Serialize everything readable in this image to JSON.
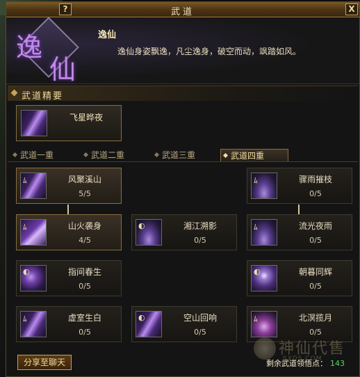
{
  "window": {
    "title": "武道",
    "help_label": "?",
    "close_label": "X"
  },
  "header": {
    "emblem_char1": "逸",
    "emblem_char2": "仙",
    "name": "逸仙",
    "description": "逸仙身姿飘逸，凡尘逸身，破空而动，飒踏如风。"
  },
  "section": {
    "title": "武道精要"
  },
  "featured": {
    "name": "飞星晔夜",
    "icon": "flying-star-icon"
  },
  "tabs": [
    {
      "label": "武道一重",
      "active": false
    },
    {
      "label": "武道二重",
      "active": false
    },
    {
      "label": "武道三重",
      "active": false
    },
    {
      "label": "武道四重",
      "active": true
    }
  ],
  "skills": [
    {
      "name": "风聚溪山",
      "level": "5/5",
      "learned": true,
      "icon": "wind-blade-icon"
    },
    {
      "name": "骤雨摧枝",
      "level": "0/5",
      "learned": false,
      "icon": "rain-blade-icon"
    },
    {
      "name": "山火袭身",
      "level": "4/5",
      "learned": true,
      "icon": "fire-blade-icon"
    },
    {
      "name": "湘江溯影",
      "level": "0/5",
      "learned": false,
      "icon": "river-wave-icon"
    },
    {
      "name": "流光夜雨",
      "level": "0/5",
      "learned": false,
      "icon": "night-rain-icon"
    },
    {
      "name": "指间春生",
      "level": "0/5",
      "learned": false,
      "icon": "spring-moon-icon"
    },
    {
      "name": "朝暮同辉",
      "level": "0/5",
      "learned": false,
      "icon": "dusk-dawn-icon"
    },
    {
      "name": "虚室生白",
      "level": "0/5",
      "learned": false,
      "icon": "void-blade-icon"
    },
    {
      "name": "空山回响",
      "level": "0/5",
      "learned": false,
      "icon": "echo-blade-icon"
    },
    {
      "name": "北溟揽月",
      "level": "0/5",
      "learned": false,
      "icon": "north-sea-moon-icon"
    }
  ],
  "footer": {
    "share_label": "分享至聊天",
    "remaining_label": "剩余武道领悟点：",
    "remaining_value": "143"
  },
  "watermark": {
    "text": "神仙代售",
    "url": "SXDS.COM"
  },
  "colors": {
    "accent_gold": "#c9a25a",
    "points_green": "#58d860",
    "emblem_purple": "#c08ae8"
  }
}
